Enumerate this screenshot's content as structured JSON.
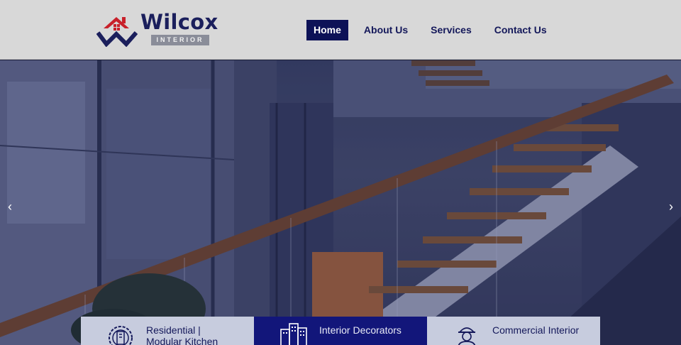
{
  "brand": {
    "name": "Wilcox",
    "tagline": "INTERIOR",
    "colors": {
      "navy": "#1b1f5c",
      "red": "#c8202a",
      "gray": "#8a8d99"
    }
  },
  "nav": {
    "items": [
      {
        "label": "Home",
        "active": true
      },
      {
        "label": "About Us",
        "active": false
      },
      {
        "label": "Services",
        "active": false
      },
      {
        "label": "Contact Us",
        "active": false
      }
    ]
  },
  "hero": {
    "image": "staircase-interior-photo",
    "prev_icon": "chevron-left-icon",
    "next_icon": "chevron-right-icon",
    "prev_glyph": "‹",
    "next_glyph": "›"
  },
  "services": [
    {
      "label": "Residential |\nModular Kitchen",
      "icon": "gear-building-icon",
      "highlighted": false
    },
    {
      "label": "Interior Decorators",
      "icon": "buildings-icon",
      "highlighted": true
    },
    {
      "label": "Commercial Interior",
      "icon": "worker-icon",
      "highlighted": false
    }
  ]
}
